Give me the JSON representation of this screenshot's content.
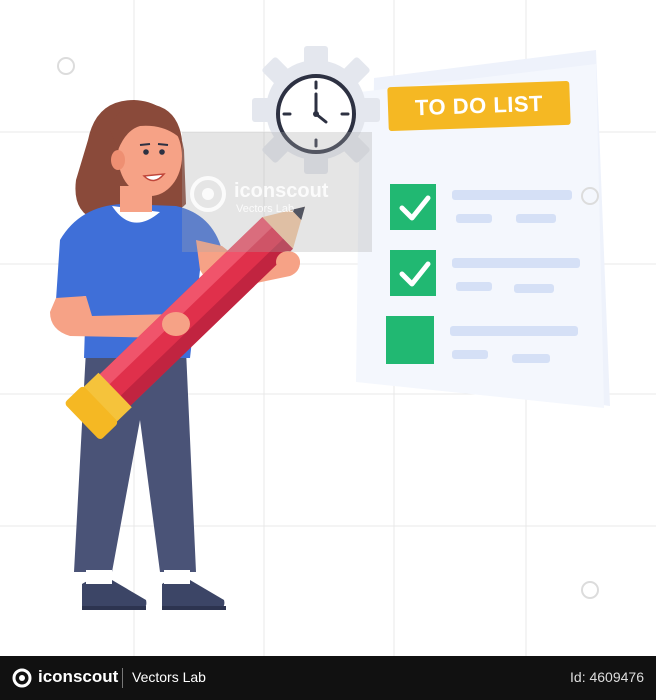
{
  "illustration": {
    "checklist_title": "TO DO LIST",
    "checklist_items": [
      {
        "checked": true
      },
      {
        "checked": true
      },
      {
        "checked": false
      }
    ],
    "colors": {
      "title_banner": "#f5b823",
      "checkbox": "#21b872",
      "paper": "#eef2fb",
      "pencil": "#e0304b",
      "shirt": "#3f6fd8",
      "pants": "#4a5377",
      "hair": "#8a4a3a"
    }
  },
  "watermark": {
    "brand": "iconscout",
    "sub": "Vectors Lab"
  },
  "footer": {
    "brand": "iconscout",
    "lab": "Vectors Lab",
    "asset_id": "Id: 4609476"
  }
}
